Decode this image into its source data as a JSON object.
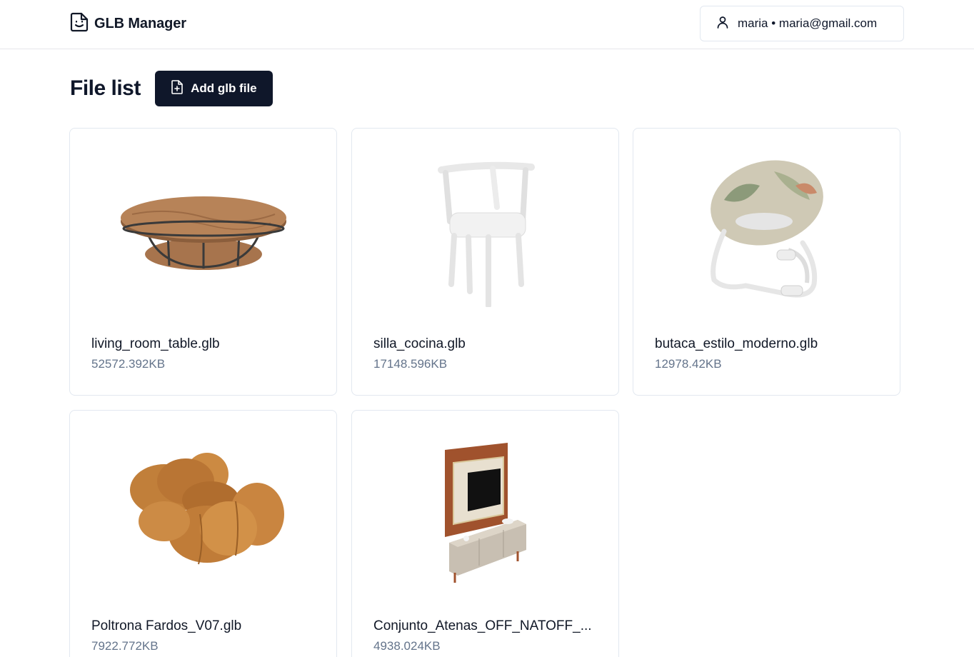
{
  "header": {
    "app_name": "GLB Manager",
    "user_label": "maria • maria@gmail.com"
  },
  "main": {
    "title": "File list",
    "add_button_label": "Add glb file",
    "files": [
      {
        "name": "living_room_table.glb",
        "size": "52572.392KB",
        "preview": "round wooden coffee table"
      },
      {
        "name": "silla_cocina.glb",
        "size": "17148.596KB",
        "preview": "white kitchen chair"
      },
      {
        "name": "butaca_estilo_moderno.glb",
        "size": "12978.42KB",
        "preview": "floral rocking armchair"
      },
      {
        "name": "Poltrona Fardos_V07.glb",
        "size": "7922.772KB",
        "preview": "tan leather lounge chair"
      },
      {
        "name": "Conjunto_Atenas_OFF_NATOFF_...",
        "size": "4938.024KB",
        "preview": "tv wall panel with sideboard"
      }
    ]
  },
  "colors": {
    "primary": "#0f172a",
    "border": "#e2e8f0",
    "muted_text": "#64748b"
  }
}
